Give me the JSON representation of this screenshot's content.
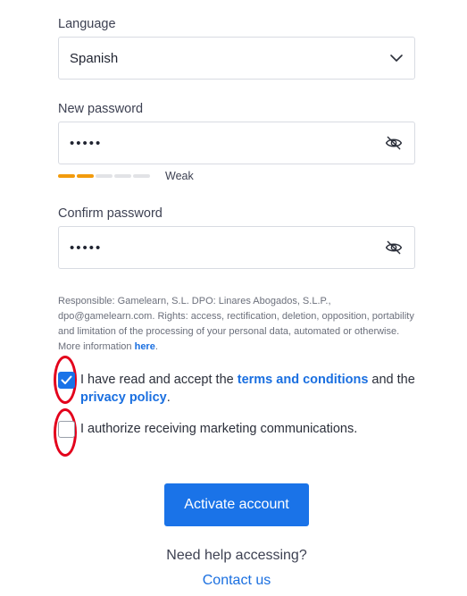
{
  "language": {
    "label": "Language",
    "value": "Spanish"
  },
  "new_password": {
    "label": "New password",
    "value": "•••••",
    "strength": "Weak",
    "strength_level": 0.4
  },
  "confirm_password": {
    "label": "Confirm password",
    "value": "•••••"
  },
  "legal": {
    "text": "Responsible: Gamelearn, S.L. DPO: Linares Abogados, S.L.P., dpo@gamelearn.com. Rights: access, rectification, deletion, opposition, portability and limitation of the processing of your personal data, automated or otherwise. More information ",
    "link": "here",
    "end": "."
  },
  "terms": {
    "checked": true,
    "part1": "I have read and accept the ",
    "terms_link": "terms and conditions",
    "part2": " and the ",
    "privacy_link": "privacy policy",
    "part3": "."
  },
  "marketing": {
    "checked": false,
    "text": "I authorize receiving marketing communications."
  },
  "activate_button": "Activate account",
  "help_text": "Need help accessing?",
  "contact_link": "Contact us",
  "colors": {
    "accent": "#1a73e8",
    "weak": "#f29b0c",
    "highlight_ring": "#e3001b"
  }
}
